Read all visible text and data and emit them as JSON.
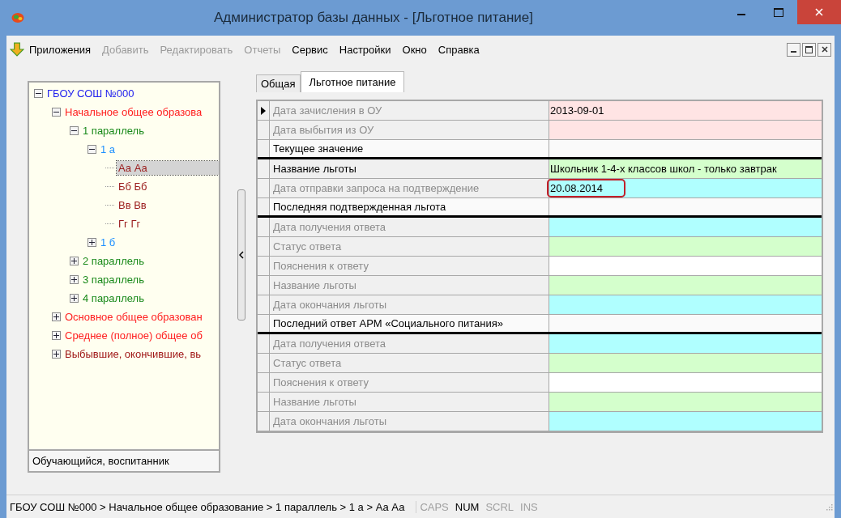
{
  "window": {
    "title": "Администратор базы данных - [Льготное питание]"
  },
  "menu": [
    {
      "label": "Приложения",
      "disabled": false
    },
    {
      "label": "Добавить",
      "disabled": true
    },
    {
      "label": "Редактировать",
      "disabled": true
    },
    {
      "label": "Отчеты",
      "disabled": true
    },
    {
      "label": "Сервис",
      "disabled": false
    },
    {
      "label": "Настройки",
      "disabled": false
    },
    {
      "label": "Окно",
      "disabled": false
    },
    {
      "label": "Справка",
      "disabled": false
    }
  ],
  "tree": [
    {
      "label": "ГБОУ СОШ №000",
      "color": "#2222ee",
      "expanded": true,
      "selected": false,
      "children": [
        {
          "label": "Начальное общее образова",
          "color": "#ff2020",
          "expanded": true,
          "selected": false,
          "children": [
            {
              "label": "1 параллель",
              "color": "#1a8a1a",
              "expanded": true,
              "selected": false,
              "children": [
                {
                  "label": "1 а",
                  "color": "#1e90ff",
                  "expanded": true,
                  "selected": false,
                  "children": [
                    {
                      "label": "Аа Аа",
                      "color": "#9a1a1a",
                      "selected": true
                    },
                    {
                      "label": "Бб Бб",
                      "color": "#9a1a1a",
                      "selected": false
                    },
                    {
                      "label": "Вв Вв",
                      "color": "#9a1a1a",
                      "selected": false
                    },
                    {
                      "label": "Гг Гг",
                      "color": "#9a1a1a",
                      "selected": false
                    }
                  ]
                },
                {
                  "label": "1 б",
                  "color": "#1e90ff",
                  "expanded": false,
                  "selected": false
                }
              ]
            },
            {
              "label": "2 параллель",
              "color": "#1a8a1a",
              "expanded": false,
              "selected": false
            },
            {
              "label": "3 параллель",
              "color": "#1a8a1a",
              "expanded": false,
              "selected": false
            },
            {
              "label": "4 параллель",
              "color": "#1a8a1a",
              "expanded": false,
              "selected": false
            }
          ]
        },
        {
          "label": "Основное общее образован",
          "color": "#ff2020",
          "expanded": false,
          "selected": false
        },
        {
          "label": "Среднее (полное) общее об",
          "color": "#ff2020",
          "expanded": false,
          "selected": false
        },
        {
          "label": "Выбывшие, окончившие, вь",
          "color": "#a01818",
          "expanded": false,
          "selected": false
        }
      ]
    }
  ],
  "tree_footer": "Обучающийся, воспитанник",
  "tabs": [
    {
      "label": "Общая",
      "selected": false
    },
    {
      "label": "Льготное питание",
      "selected": true
    }
  ],
  "grid": [
    {
      "kind": "field",
      "label": "Дата зачисления в ОУ",
      "value": "2013-09-01",
      "color": "#ffe4e4",
      "disabled": true,
      "current": true,
      "highlighted": false
    },
    {
      "kind": "field",
      "label": "Дата выбытия из ОУ",
      "color": "#ffe4e4",
      "disabled": true,
      "current": false
    },
    {
      "kind": "header",
      "label": "Текущее значение"
    },
    {
      "kind": "field",
      "label": "Название льготы",
      "value": "Школьник 1-4-х классов школ - только завтрак",
      "color": "#d4ffcc",
      "disabled": false,
      "current": false,
      "highlighted": false
    },
    {
      "kind": "field",
      "label": "Дата отправки запроса на подтверждение",
      "value": "20.08.2014",
      "color": "#b0ffff",
      "disabled": true,
      "current": false,
      "highlighted": true
    },
    {
      "kind": "header",
      "label": "Последняя подтвержденная льгота"
    },
    {
      "kind": "field",
      "label": "Дата получения ответа",
      "color": "#b0ffff",
      "disabled": true,
      "current": false
    },
    {
      "kind": "field",
      "label": "Статус ответа",
      "color": "#d4ffcc",
      "disabled": true,
      "current": false
    },
    {
      "kind": "field",
      "label": "Пояснения к ответу",
      "color": "#ffffff",
      "disabled": true,
      "current": false
    },
    {
      "kind": "field",
      "label": "Название льготы",
      "color": "#d4ffcc",
      "disabled": true,
      "current": false
    },
    {
      "kind": "field",
      "label": "Дата окончания льготы",
      "color": "#b0ffff",
      "disabled": true,
      "current": false
    },
    {
      "kind": "header",
      "label": "Последний ответ АРМ «Социального питания»"
    },
    {
      "kind": "field",
      "label": "Дата получения ответа",
      "color": "#b0ffff",
      "disabled": true,
      "current": false
    },
    {
      "kind": "field",
      "label": "Статус ответа",
      "color": "#d4ffcc",
      "disabled": true,
      "current": false
    },
    {
      "kind": "field",
      "label": "Пояснения к ответу",
      "color": "#ffffff",
      "disabled": true,
      "current": false
    },
    {
      "kind": "field",
      "label": "Название льготы",
      "color": "#d4ffcc",
      "disabled": true,
      "current": false
    },
    {
      "kind": "field",
      "label": "Дата окончания льготы",
      "color": "#b0ffff",
      "disabled": true,
      "current": false
    }
  ],
  "status_bar": {
    "path": "ГБОУ СОШ №000 > Начальное общее образование > 1 параллель > 1 а > Аа Аа",
    "indicators": [
      {
        "label": "CAPS",
        "on": false
      },
      {
        "label": "NUM",
        "on": true
      },
      {
        "label": "SCRL",
        "on": false
      },
      {
        "label": "INS",
        "on": false
      }
    ]
  }
}
